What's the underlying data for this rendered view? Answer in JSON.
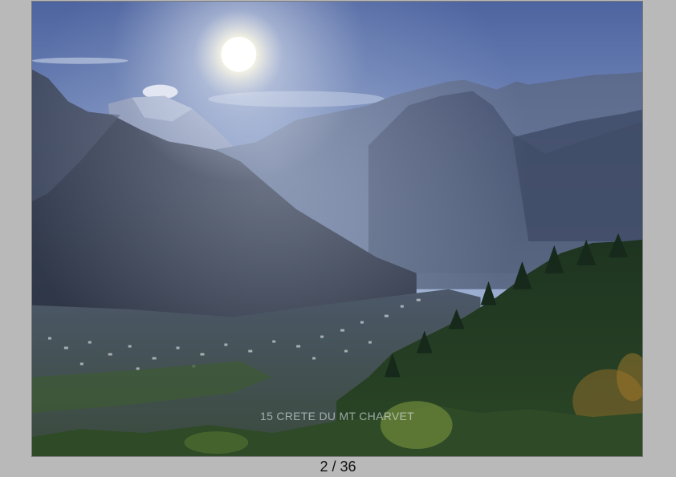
{
  "viewer": {
    "photo_watermark": "15 CRETE DU MT CHARVET",
    "counter": "2 / 36"
  },
  "colors": {
    "background": "#b9b9b9",
    "sky": "#5d74a8",
    "mountain": "#3a4358",
    "forest": "#1f3a24"
  }
}
